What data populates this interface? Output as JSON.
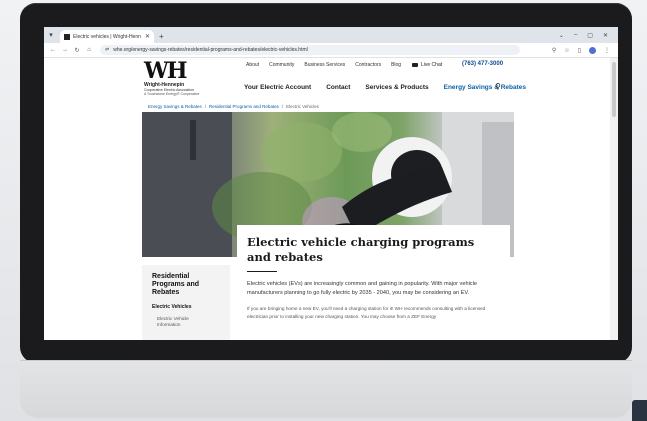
{
  "browser": {
    "tab_title": "Electric vehicles | Wright-Henn",
    "url": "whe.org/energy-savings-rebates/residential-programs-and-rebates/electric-vehicles.html"
  },
  "site": {
    "logo_mark": "WH",
    "logo_amp": "&",
    "logo_name": "Wright-Hennepin",
    "logo_sub": "Cooperative Electric Association",
    "logo_tag": "A Touchstone Energy® Cooperative",
    "top_links": [
      "About",
      "Community",
      "Business Services",
      "Contractors",
      "Blog"
    ],
    "live_chat": "Live Chat",
    "phone": "(763) 477-3000",
    "main_nav": [
      "Your Electric Account",
      "Contact",
      "Services & Products",
      "Energy Savings & Rebates"
    ],
    "active_nav": "Energy Savings & Rebates"
  },
  "breadcrumb": {
    "items": [
      "Energy Savings & Rebates",
      "Residential Programs and Rebates"
    ],
    "separator": "/",
    "current": "Electric Vehicles"
  },
  "content": {
    "title": "Electric vehicle charging programs and rebates",
    "intro": "Electric vehicles (EVs) are increasingly common and gaining in popularity. With major vehicle manufacturers planning to go fully electric by 2035 - 2040, you may be considering an EV.",
    "body": "If you are bringing home a new EV, you'll need a charging station for it! WH recommends consulting with a licensed electrician prior to installing your new charging station. You may choose from a ZEF Energy"
  },
  "sidebar": {
    "title": "Residential Programs and Rebates",
    "subtitle": "Electric Vehicles",
    "items": [
      "Electric Vehicle Information"
    ]
  },
  "colors": {
    "brand_blue": "#0d5fa6",
    "phone_blue": "#0d4a8f",
    "bezel": "#1b1b1d"
  },
  "icons": {
    "search": "search-icon",
    "chat": "chat-icon"
  }
}
